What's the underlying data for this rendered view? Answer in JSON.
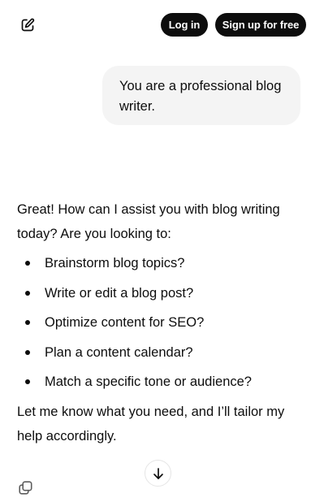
{
  "header": {
    "new_chat_icon": "compose-icon",
    "login_label": "Log in",
    "signup_label": "Sign up for free"
  },
  "conversation": {
    "user_message": "You are a professional blog writer.",
    "assistant": {
      "intro": "Great! How can I assist you with blog writing today? Are you looking to:",
      "options": [
        "Brainstorm blog topics?",
        "Write or edit a blog post?",
        "Optimize content for SEO?",
        "Plan a content calendar?",
        "Match a specific tone or audience?"
      ],
      "closing": "Let me know what you need, and I’ll tailor my help accordingly."
    }
  },
  "actions": {
    "copy_icon": "copy-icon",
    "scroll_icon": "arrow-down-icon"
  },
  "colors": {
    "text": "#0d0d0d",
    "bubble_bg": "#f4f4f4",
    "button_bg": "#0d0d0d",
    "button_text": "#ffffff"
  }
}
